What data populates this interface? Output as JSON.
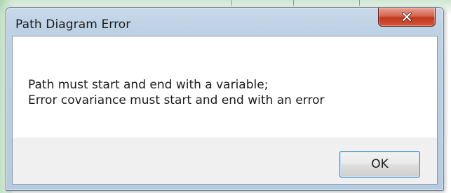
{
  "dialog": {
    "title": "Path Diagram Error",
    "close_icon": "close-icon",
    "message_lines": [
      "Path must start and end with a variable;",
      "Error covariance must start and end with an error"
    ],
    "ok_label": "OK"
  },
  "colors": {
    "frame": "#bed2e6",
    "close_button": "#c2381c",
    "content_background": "#ffffff",
    "footer_background": "#f0f0f0",
    "ok_border": "#3c7fb1"
  }
}
